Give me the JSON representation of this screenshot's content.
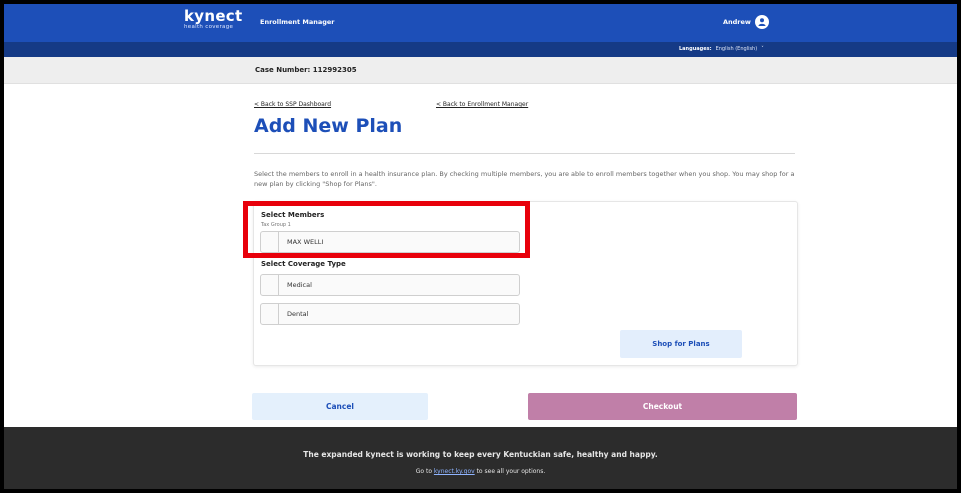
{
  "header": {
    "logo_word": "kynect",
    "logo_sub": "health coverage",
    "app_title": "Enrollment Manager",
    "user_name": "Andrew",
    "language_label": "Languages:",
    "language_value": "English (English)",
    "chevron": "˅"
  },
  "case": {
    "label": "Case Number: 112992305"
  },
  "nav": {
    "back_ssp": "< Back to SSP Dashboard",
    "back_enrollment": "< Back to Enrollment Manager"
  },
  "page": {
    "title": "Add New Plan",
    "description": "Select the members to enroll in a health insurance plan. By checking multiple members, you are able to enroll members together when you shop. You may shop for a new plan by clicking \"Shop for Plans\"."
  },
  "members": {
    "label": "Select Members",
    "tax_group": "Tax Group 1",
    "items": [
      "MAX WELLI"
    ]
  },
  "coverage": {
    "label": "Select Coverage Type",
    "items": [
      "Medical",
      "Dental"
    ]
  },
  "buttons": {
    "shop": "Shop for Plans",
    "cancel": "Cancel",
    "checkout": "Checkout"
  },
  "footer": {
    "line1": "The expanded kynect is working to keep every Kentuckian safe, healthy and happy.",
    "line2_pre": "Go to ",
    "line2_link": "kynect.ky.gov",
    "line2_post": " to see all your options."
  },
  "colors": {
    "brand_blue": "#1d4fb8",
    "checkout_disabled": "#c07fa8",
    "highlight_red": "#e8000b"
  }
}
